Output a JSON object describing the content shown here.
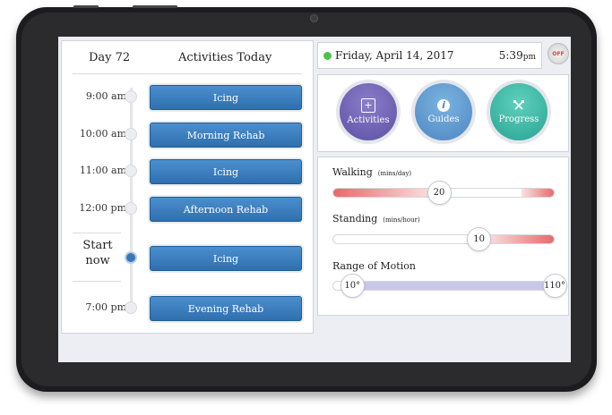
{
  "header": {
    "day": "Day 72",
    "title": "Activities Today"
  },
  "schedule": [
    {
      "time": "9:00 am",
      "activity": "Icing"
    },
    {
      "time": "10:00 am",
      "activity": "Morning Rehab"
    },
    {
      "time": "11:00 am",
      "activity": "Icing"
    },
    {
      "time": "12:00 pm",
      "activity": "Afternoon Rehab"
    }
  ],
  "now": {
    "label_line1": "Start",
    "label_line2": "now",
    "activity": "Icing"
  },
  "evening": {
    "time": "7:00 pm",
    "activity": "Evening Rehab"
  },
  "status": {
    "date": "Friday, April 14, 2017",
    "time": "5:39",
    "ampm": "pm",
    "power": "OFF",
    "online_color": "#4cc24c"
  },
  "nav": [
    {
      "label": "Activities",
      "icon": "plus-square-icon"
    },
    {
      "label": "Guides",
      "icon": "info-icon"
    },
    {
      "label": "Progress",
      "icon": "dumbbell-icon"
    }
  ],
  "sliders": {
    "walking": {
      "label": "Walking",
      "unit": "(mins/day)",
      "value": "20",
      "level": 0.48
    },
    "standing": {
      "label": "Standing",
      "unit": "(mins/hour)",
      "value": "10",
      "level": 0.66
    },
    "rom": {
      "label": "Range of Motion",
      "min": "10°",
      "max": "110°",
      "level_min": 0.09,
      "level_max": 1.0
    }
  },
  "colors": {
    "accent": "#3a78b5",
    "activities": "#6a5cb0",
    "guides": "#5b93cd",
    "progress": "#33b09f",
    "warn": "#e8696a"
  }
}
